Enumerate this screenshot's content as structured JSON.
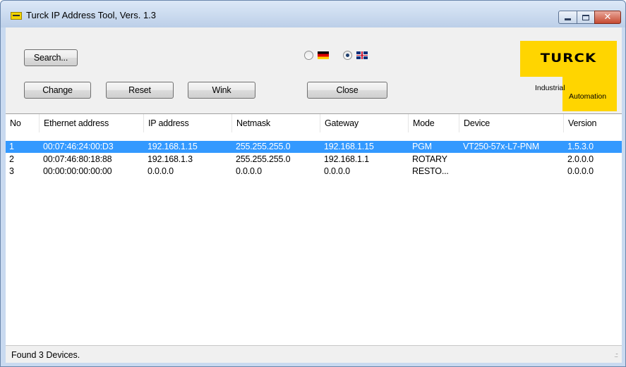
{
  "window": {
    "title": "Turck IP Address Tool, Vers. 1.3"
  },
  "toolbar": {
    "search_label": "Search...",
    "change_label": "Change",
    "reset_label": "Reset",
    "wink_label": "Wink",
    "close_label": "Close"
  },
  "language": {
    "options": [
      {
        "flag": "de-flag-icon",
        "selected": false
      },
      {
        "flag": "uk-flag-icon",
        "selected": true
      }
    ]
  },
  "logo": {
    "brand": "TURCK",
    "line1": "Industrial",
    "line2": "Automation",
    "color": "#ffd500"
  },
  "table": {
    "columns": [
      "No",
      "Ethernet address",
      "IP address",
      "Netmask",
      "Gateway",
      "Mode",
      "Device",
      "Version"
    ],
    "rows": [
      {
        "no": "1",
        "mac": "00:07:46:24:00:D3",
        "ip": "192.168.1.15",
        "netmask": "255.255.255.0",
        "gateway": "192.168.1.15",
        "mode": "PGM",
        "device": "VT250-57x-L7-PNM",
        "version": "1.5.3.0",
        "selected": true
      },
      {
        "no": "2",
        "mac": "00:07:46:80:18:88",
        "ip": "192.168.1.3",
        "netmask": "255.255.255.0",
        "gateway": "192.168.1.1",
        "mode": "ROTARY",
        "device": "",
        "version": "2.0.0.0",
        "selected": false
      },
      {
        "no": "3",
        "mac": "00:00:00:00:00:00",
        "ip": "0.0.0.0",
        "netmask": "0.0.0.0",
        "gateway": "0.0.0.0",
        "mode": "RESTO...",
        "device": "",
        "version": "0.0.0.0",
        "selected": false
      }
    ],
    "selection_color": "#3399ff"
  },
  "status": {
    "text": "Found 3 Devices."
  }
}
